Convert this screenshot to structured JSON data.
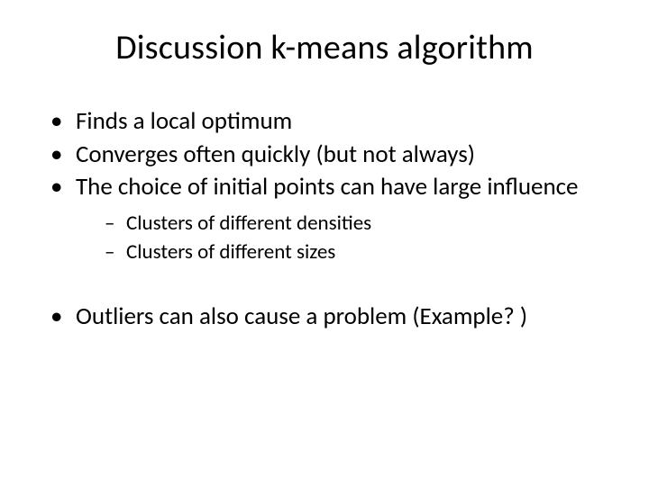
{
  "slide": {
    "title": "Discussion k-means algorithm",
    "bullets": [
      {
        "text": "Finds a local optimum"
      },
      {
        "text": "Converges often quickly (but not always)"
      },
      {
        "text": "The choice of initial points can have large influence",
        "sub": [
          "Clusters of different densities",
          "Clusters of different sizes"
        ]
      },
      {
        "text": "Outliers can also cause a problem (Example? )"
      }
    ]
  }
}
